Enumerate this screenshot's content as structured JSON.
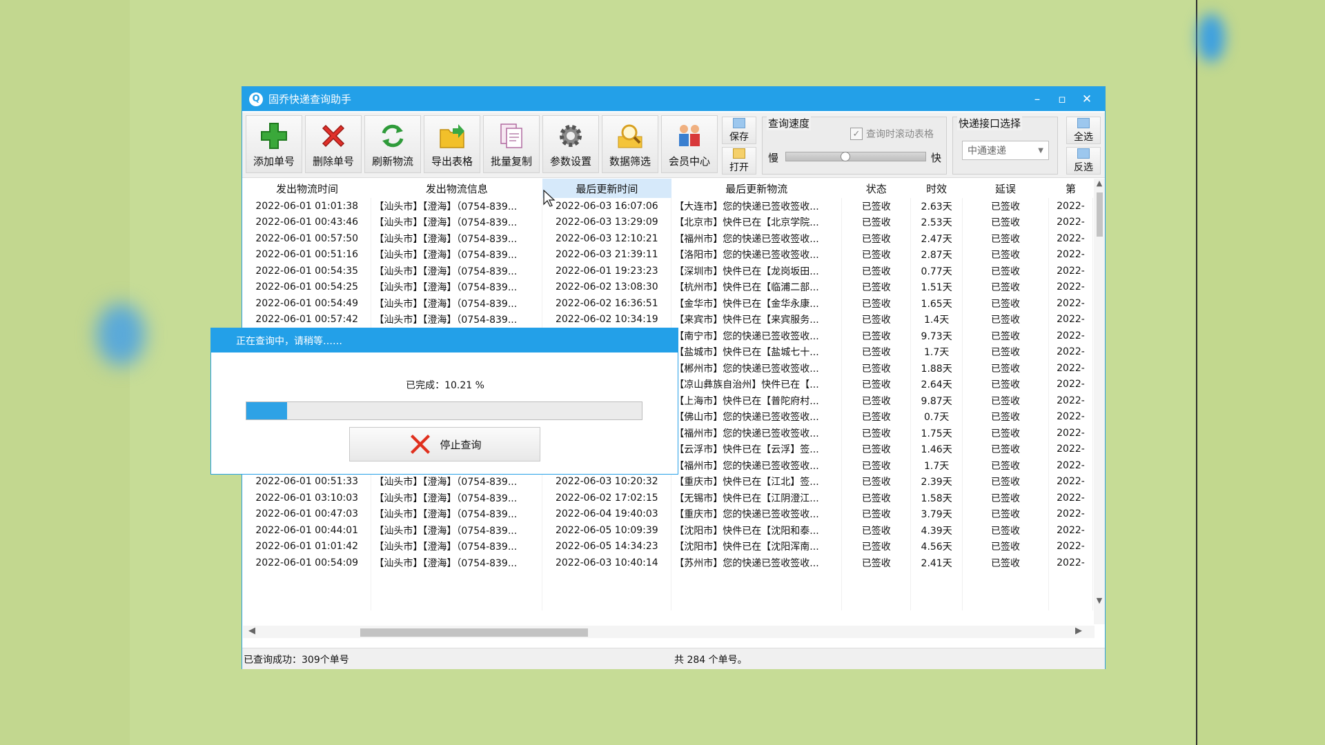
{
  "window": {
    "title": "固乔快递查询助手",
    "controls": [
      "–",
      "▫",
      "✕"
    ]
  },
  "toolbar": {
    "buttons": [
      {
        "label": "添加单号",
        "icon": "add-icon"
      },
      {
        "label": "删除单号",
        "icon": "delete-icon"
      },
      {
        "label": "刷新物流",
        "icon": "refresh-icon"
      },
      {
        "label": "导出表格",
        "icon": "export-icon"
      },
      {
        "label": "批量复制",
        "icon": "copy-icon"
      },
      {
        "label": "参数设置",
        "icon": "gear-icon"
      },
      {
        "label": "数据筛选",
        "icon": "search-icon"
      },
      {
        "label": "会员中心",
        "icon": "members-icon"
      }
    ],
    "save_label": "保存",
    "open_label": "打开",
    "speed": {
      "title": "查询速度",
      "scroll_label": "查询时滚动表格",
      "scroll_checked": true,
      "slow": "慢",
      "fast": "快",
      "level": 0.4
    },
    "api": {
      "title": "快递接口选择",
      "selected": "中通速递"
    },
    "select_all": "全选",
    "invert": "反选"
  },
  "table": {
    "headers": [
      "发出物流时间",
      "发出物流信息",
      "最后更新时间",
      "最后更新物流",
      "状态",
      "时效",
      "延误",
      "第"
    ],
    "sorted_column": 2,
    "rows": [
      [
        "2022-06-01 01:01:38",
        "【汕头市】【澄海】（0754-839...",
        "2022-06-03 16:07:06",
        "【大连市】您的快递已签收签收...",
        "已签收",
        "2.63天",
        "已签收",
        "2022-"
      ],
      [
        "2022-06-01 00:43:46",
        "【汕头市】【澄海】（0754-839...",
        "2022-06-03 13:29:09",
        "【北京市】快件已在【北京学院...",
        "已签收",
        "2.53天",
        "已签收",
        "2022-"
      ],
      [
        "2022-06-01 00:57:50",
        "【汕头市】【澄海】（0754-839...",
        "2022-06-03 12:10:21",
        "【福州市】您的快递已签收签收...",
        "已签收",
        "2.47天",
        "已签收",
        "2022-"
      ],
      [
        "2022-06-01 00:51:16",
        "【汕头市】【澄海】（0754-839...",
        "2022-06-03 21:39:11",
        "【洛阳市】您的快递已签收签收...",
        "已签收",
        "2.87天",
        "已签收",
        "2022-"
      ],
      [
        "2022-06-01 00:54:35",
        "【汕头市】【澄海】（0754-839...",
        "2022-06-01 19:23:23",
        "【深圳市】快件已在【龙岗坂田...",
        "已签收",
        "0.77天",
        "已签收",
        "2022-"
      ],
      [
        "2022-06-01 00:54:25",
        "【汕头市】【澄海】（0754-839...",
        "2022-06-02 13:08:30",
        "【杭州市】快件已在【临浦二部...",
        "已签收",
        "1.51天",
        "已签收",
        "2022-"
      ],
      [
        "2022-06-01 00:54:49",
        "【汕头市】【澄海】（0754-839...",
        "2022-06-02 16:36:51",
        "【金华市】快件已在【金华永康...",
        "已签收",
        "1.65天",
        "已签收",
        "2022-"
      ],
      [
        "2022-06-01 00:57:42",
        "【汕头市】【澄海】（0754-839...",
        "2022-06-02 10:34:19",
        "【来宾市】快件已在【来宾服务...",
        "已签收",
        "1.4天",
        "已签收",
        "2022-"
      ],
      [
        "",
        "",
        "",
        "【南宁市】您的快递已签收签收...",
        "已签收",
        "9.73天",
        "已签收",
        "2022-"
      ],
      [
        "",
        "",
        "",
        "【盐城市】快件已在【盐城七十...",
        "已签收",
        "1.7天",
        "已签收",
        "2022-"
      ],
      [
        "",
        "",
        "",
        "【郴州市】您的快递已签收签收...",
        "已签收",
        "1.88天",
        "已签收",
        "2022-"
      ],
      [
        "",
        "",
        "",
        "【凉山彝族自治州】快件已在【...",
        "已签收",
        "2.64天",
        "已签收",
        "2022-"
      ],
      [
        "",
        "",
        "",
        "【上海市】快件已在【普陀府村...",
        "已签收",
        "9.87天",
        "已签收",
        "2022-"
      ],
      [
        "",
        "",
        "",
        "【佛山市】您的快递已签收签收...",
        "已签收",
        "0.7天",
        "已签收",
        "2022-"
      ],
      [
        "",
        "",
        "",
        "【福州市】您的快递已签收签收...",
        "已签收",
        "1.75天",
        "已签收",
        "2022-"
      ],
      [
        "",
        "",
        "",
        "【云浮市】快件已在【云浮】签...",
        "已签收",
        "1.46天",
        "已签收",
        "2022-"
      ],
      [
        "",
        "",
        "",
        "【福州市】您的快递已签收签收...",
        "已签收",
        "1.7天",
        "已签收",
        "2022-"
      ],
      [
        "2022-06-01 00:51:33",
        "【汕头市】【澄海】（0754-839...",
        "2022-06-03 10:20:32",
        "【重庆市】快件已在【江北】签...",
        "已签收",
        "2.39天",
        "已签收",
        "2022-"
      ],
      [
        "2022-06-01 03:10:03",
        "【汕头市】【澄海】（0754-839...",
        "2022-06-02 17:02:15",
        "【无锡市】快件已在【江阴澄江...",
        "已签收",
        "1.58天",
        "已签收",
        "2022-"
      ],
      [
        "2022-06-01 00:47:03",
        "【汕头市】【澄海】（0754-839...",
        "2022-06-04 19:40:03",
        "【重庆市】您的快递已签收签收...",
        "已签收",
        "3.79天",
        "已签收",
        "2022-"
      ],
      [
        "2022-06-01 00:44:01",
        "【汕头市】【澄海】（0754-839...",
        "2022-06-05 10:09:39",
        "【沈阳市】快件已在【沈阳和泰...",
        "已签收",
        "4.39天",
        "已签收",
        "2022-"
      ],
      [
        "2022-06-01 01:01:42",
        "【汕头市】【澄海】（0754-839...",
        "2022-06-05 14:34:23",
        "【沈阳市】快件已在【沈阳浑南...",
        "已签收",
        "4.56天",
        "已签收",
        "2022-"
      ],
      [
        "2022-06-01 00:54:09",
        "【汕头市】【澄海】（0754-839...",
        "2022-06-03 10:40:14",
        "【苏州市】您的快递已签收签收...",
        "已签收",
        "2.41天",
        "已签收",
        "2022-"
      ]
    ]
  },
  "status": {
    "left": "已查询成功：309个单号",
    "right": "共 284 个单号。"
  },
  "dialog": {
    "title": "正在查询中，请稍等……",
    "done_text": "已完成：10.21 %",
    "progress": 0.1021,
    "stop_label": "停止查询"
  },
  "colors": {
    "accent": "#23a0e8",
    "background": "#c6dc96"
  }
}
